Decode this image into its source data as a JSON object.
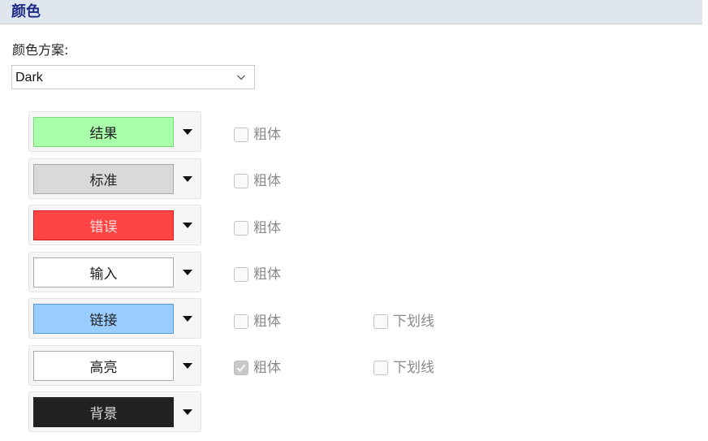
{
  "section": {
    "title": "颜色"
  },
  "scheme": {
    "label": "颜色方案:",
    "value": "Dark"
  },
  "colors": {
    "swatch_fill": [
      "#aaffaa",
      "#d9d9d9",
      "#ff4444",
      "#ffffff",
      "#99ccff",
      "#ffffff",
      "#222222"
    ],
    "swatch_text": [
      "#222222",
      "#222222",
      "#ffdddd",
      "#222222",
      "#222222",
      "#222222",
      "#dddddd"
    ],
    "swatch_border": [
      "#77dd77",
      "#a8a8a8",
      "#d02020",
      "#aaaaaa",
      "#5599dd",
      "#aaaaaa",
      "#222222"
    ]
  },
  "rows": [
    {
      "label": "结果",
      "bold_label": "粗体",
      "bold_checked": false
    },
    {
      "label": "标准",
      "bold_label": "粗体",
      "bold_checked": false
    },
    {
      "label": "错误",
      "bold_label": "粗体",
      "bold_checked": false
    },
    {
      "label": "输入",
      "bold_label": "粗体",
      "bold_checked": false
    },
    {
      "label": "链接",
      "bold_label": "粗体",
      "bold_checked": false,
      "underline_label": "下划线",
      "underline_checked": false
    },
    {
      "label": "高亮",
      "bold_label": "粗体",
      "bold_checked": true,
      "underline_label": "下划线",
      "underline_checked": false
    },
    {
      "label": "背景"
    }
  ]
}
